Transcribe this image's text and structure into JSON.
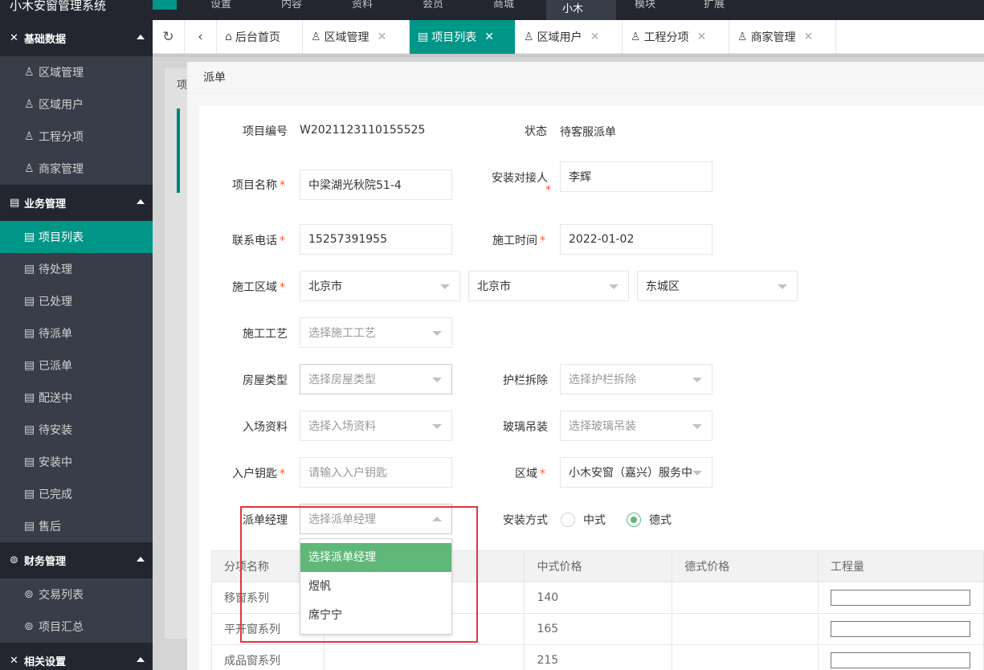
{
  "topbar": {
    "brand": "小木安窗管理系统",
    "nav": [
      "设置",
      "内容",
      "资料",
      "会员",
      "商城",
      "小木",
      "模块",
      "扩展"
    ]
  },
  "sidebar": {
    "groups": [
      {
        "label": "基础数据",
        "items": [
          "区域管理",
          "区域用户",
          "工程分项",
          "商家管理"
        ]
      },
      {
        "label": "业务管理",
        "items": [
          "项目列表",
          "待处理",
          "已处理",
          "待派单",
          "已派单",
          "配送中",
          "待安装",
          "安装中",
          "已完成",
          "售后"
        ]
      },
      {
        "label": "财务管理",
        "items": [
          "交易列表",
          "项目汇总"
        ]
      },
      {
        "label": "相关设置",
        "items": []
      }
    ],
    "active_item": "项目列表"
  },
  "tabs": [
    {
      "label": "后台首页",
      "icon": "home-icon"
    },
    {
      "label": "区域管理",
      "icon": "user-icon"
    },
    {
      "label": "项目列表",
      "icon": "doc-icon"
    },
    {
      "label": "区域用户",
      "icon": "user-icon"
    },
    {
      "label": "工程分项",
      "icon": "user-icon"
    },
    {
      "label": "商家管理",
      "icon": "user-icon"
    }
  ],
  "bg": {
    "label": "项"
  },
  "modal": {
    "title": "派单",
    "project_no_label": "项目编号",
    "project_no": "W2021123110155525",
    "status_label": "状态",
    "status": "待客服派单",
    "project_name_label": "项目名称",
    "project_name": "中梁湖光秋院51-4",
    "installer_label": "安装对接人",
    "installer": "李辉",
    "phone_label": "联系电话",
    "phone": "15257391955",
    "time_label": "施工时间",
    "time": "2022-01-02",
    "region_label": "施工区域",
    "province": "北京市",
    "city": "北京市",
    "district": "东城区",
    "craft_label": "施工工艺",
    "craft_placeholder": "选择施工工艺",
    "house_label": "房屋类型",
    "house_placeholder": "选择房屋类型",
    "rail_label": "护栏拆除",
    "rail_placeholder": "选择护栏拆除",
    "entry_label": "入场资料",
    "entry_placeholder": "选择入场资料",
    "glass_label": "玻璃吊装",
    "glass_placeholder": "选择玻璃吊装",
    "key_label": "入户钥匙",
    "key_placeholder": "请输入入户钥匙",
    "area_label": "区域",
    "area": "小木安窗（嘉兴）服务中",
    "manager_label": "派单经理",
    "manager_placeholder": "选择派单经理",
    "install_label": "安装方式",
    "install_options": [
      "中式",
      "德式"
    ],
    "install_selected": "德式",
    "manager_options": [
      "选择派单经理",
      "煜帆",
      "席宁宁"
    ],
    "table": {
      "headers": [
        "分项名称",
        "",
        "中式价格",
        "德式价格",
        "工程量"
      ],
      "rows": [
        [
          "移窗系列",
          "",
          "140",
          "",
          ""
        ],
        [
          "平开窗系列",
          "",
          "165",
          "",
          ""
        ],
        [
          "成品窗系列",
          "",
          "215",
          "",
          ""
        ]
      ]
    }
  }
}
